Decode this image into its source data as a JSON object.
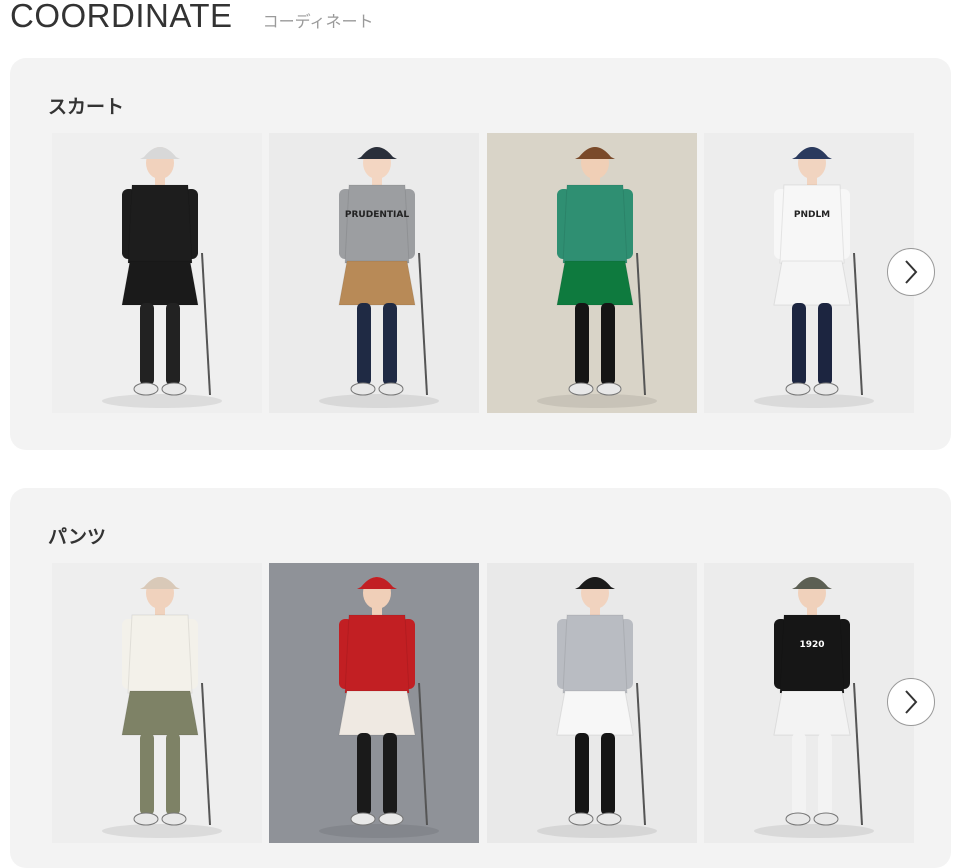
{
  "header": {
    "title": "COORDINATE",
    "subtitle": "コーディネート"
  },
  "sections": [
    {
      "title": "スカート",
      "items": [
        {
          "label": "black-quilted-vest-skirt-look",
          "bg": "#efefef",
          "top": "#1d1d1d",
          "bottom": "#1a1a1a",
          "legs": "#222222",
          "hat": "#d8d8d8",
          "skin": "#f1d2bd",
          "print": ""
        },
        {
          "label": "grey-sweater-camel-skirt-look",
          "bg": "#ebebeb",
          "top": "#9c9ea1",
          "bottom": "#b88a57",
          "legs": "#1f2a44",
          "hat": "#2a2f3a",
          "skin": "#f3d6c2",
          "print": "PRUDENTIAL"
        },
        {
          "label": "green-vest-green-skirt-look",
          "bg": "#d9d4c8",
          "top": "#2f8f72",
          "bottom": "#0e7a3e",
          "legs": "#151515",
          "hat": "#7a4a2a",
          "skin": "#f0cfb6",
          "print": ""
        },
        {
          "label": "white-sweatshirt-pleated-skirt-look",
          "bg": "#ededed",
          "top": "#f7f7f7",
          "bottom": "#f5f5f5",
          "legs": "#1c2540",
          "hat": "#2a3a5e",
          "skin": "#f1d4c0",
          "print": "PNDLM"
        }
      ]
    },
    {
      "title": "パンツ",
      "items": [
        {
          "label": "white-long-vest-olive-pants-look",
          "bg": "#eeeeee",
          "top": "#f3f1ea",
          "bottom": "#7e8266",
          "legs": "#7e8266",
          "hat": "#d9c9b8",
          "skin": "#f0d2bd",
          "print": ""
        },
        {
          "label": "red-knit-white-shorts-look",
          "bg": "#8f9298",
          "top": "#c21f23",
          "bottom": "#efe9e2",
          "legs": "#1a1a1a",
          "hat": "#c21f23",
          "skin": "#f0cfb8",
          "print": ""
        },
        {
          "label": "patterned-sweater-white-skort-look",
          "bg": "#e9e9e9",
          "top": "#b9bcc2",
          "bottom": "#f7f7f7",
          "legs": "#151515",
          "hat": "#1b1b1b",
          "skin": "#f1d3bf",
          "print": ""
        },
        {
          "label": "black-hoodie-white-pants-look",
          "bg": "#ececec",
          "top": "#161616",
          "bottom": "#f3f3f3",
          "legs": "#f3f3f3",
          "hat": "#5c5f53",
          "skin": "#f0d1bb",
          "print": "1920"
        }
      ]
    }
  ],
  "next_icon": "chevron-right-icon"
}
